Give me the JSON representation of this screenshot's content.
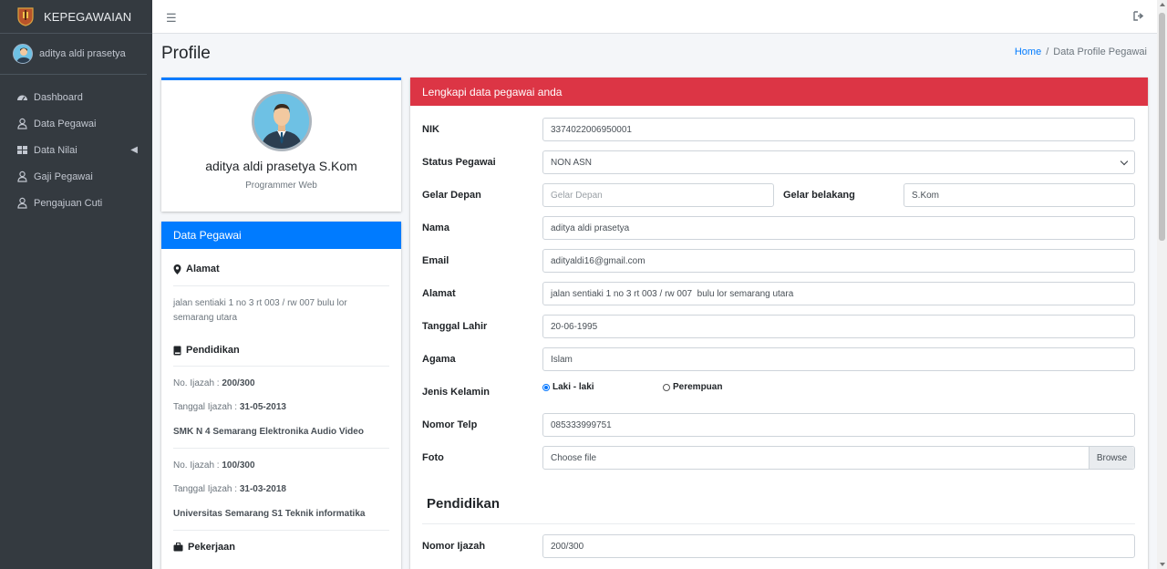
{
  "sidebar": {
    "brand": "KEPEGAWAIAN",
    "user_name": "aditya aldi prasetya",
    "items": [
      {
        "label": "Dashboard"
      },
      {
        "label": "Data Pegawai"
      },
      {
        "label": "Data Nilai"
      },
      {
        "label": "Gaji Pegawai"
      },
      {
        "label": "Pengajuan Cuti"
      }
    ]
  },
  "header": {
    "title": "Profile",
    "breadcrumb_home": "Home",
    "breadcrumb_sep": "/",
    "breadcrumb_current": "Data Profile Pegawai"
  },
  "profile": {
    "name": "aditya aldi prasetya S.Kom",
    "job": "Programmer Web"
  },
  "data_pegawai": {
    "title": "Data Pegawai",
    "alamat_title": "Alamat",
    "alamat": "jalan sentiaki 1 no 3 rt 003 / rw 007 bulu lor semarang utara",
    "pendidikan_title": "Pendidikan",
    "ijazah_label": "No. Ijazah :",
    "tanggal_label": "Tanggal Ijazah :",
    "education": [
      {
        "no": "200/300",
        "tanggal": "31-05-2013",
        "school": "SMK N 4 Semarang Elektronika Audio Video"
      },
      {
        "no": "100/300",
        "tanggal": "31-03-2018",
        "school": "Universitas Semarang S1 Teknik informatika"
      }
    ],
    "pekerjaan_title": "Pekerjaan"
  },
  "form": {
    "title": "Lengkapi data pegawai anda",
    "nik_label": "NIK",
    "nik": "3374022006950001",
    "status_label": "Status Pegawai",
    "status": "NON ASN",
    "gelar_depan_label": "Gelar Depan",
    "gelar_depan_placeholder": "Gelar Depan",
    "gelar_belakang_label": "Gelar belakang",
    "gelar_belakang": "S.Kom",
    "nama_label": "Nama",
    "nama": "aditya aldi prasetya",
    "email_label": "Email",
    "email": "adityaldi16@gmail.com",
    "alamat_label": "Alamat",
    "alamat": "jalan sentiaki 1 no 3 rt 003 / rw 007  bulu lor semarang utara",
    "tanggal_label": "Tanggal Lahir",
    "tanggal": "20-06-1995",
    "agama_label": "Agama",
    "agama": "Islam",
    "jk_label": "Jenis Kelamin",
    "jk_male": "Laki - laki",
    "jk_female": "Perempuan",
    "telp_label": "Nomor Telp",
    "telp": "085333999751",
    "foto_label": "Foto",
    "foto_placeholder": "Choose file",
    "browse": "Browse",
    "pendidikan_heading": "Pendidikan",
    "ijazah_label": "Nomor Ijazah",
    "ijazah": "200/300"
  },
  "colors": {
    "sidebar": "#343a40",
    "primary": "#007bff",
    "danger": "#dc3545"
  }
}
